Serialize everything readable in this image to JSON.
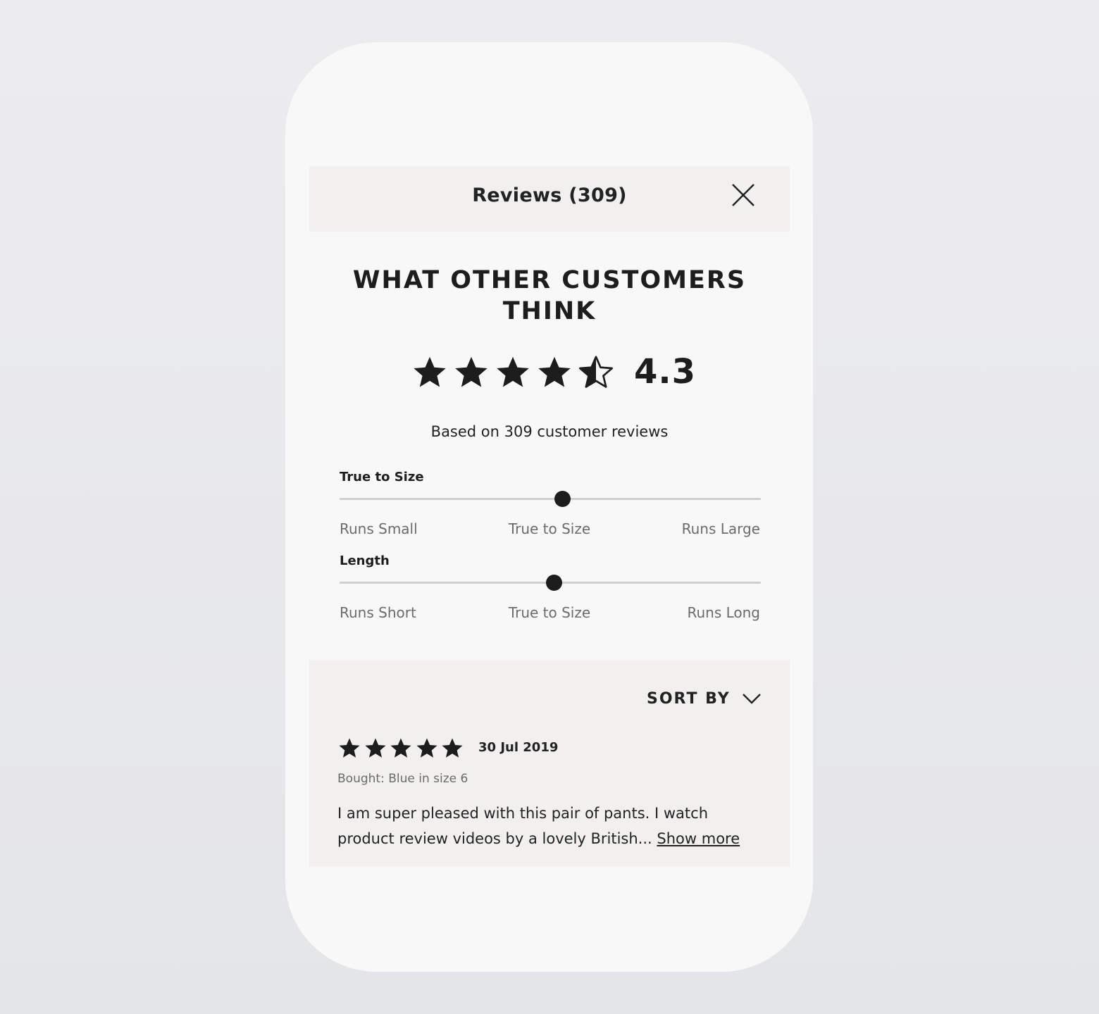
{
  "header": {
    "title": "Reviews (309)",
    "close_icon": "close-icon"
  },
  "summary": {
    "headline": "WHAT OTHER CUSTOMERS THINK",
    "rating_value": "4.3",
    "rating_stars": 4.3,
    "based_on": "Based on 309 customer reviews"
  },
  "fit": {
    "size": {
      "label": "True to Size",
      "position_fraction": 0.53,
      "min_label": "Runs Small",
      "mid_label": "True to Size",
      "max_label": "Runs Large"
    },
    "length": {
      "label": "Length",
      "position_fraction": 0.51,
      "min_label": "Runs Short",
      "mid_label": "True to Size",
      "max_label": "Runs Long"
    }
  },
  "sort": {
    "label": "SORT BY",
    "icon": "chevron-down-icon"
  },
  "review": {
    "stars": 5,
    "date": "30 Jul 2019",
    "bought": "Bought: Blue in size 6",
    "text": "I am super pleased with this pair of pants. I watch product review videos by a lovely British...",
    "show_more": "Show more"
  },
  "colors": {
    "star": "#1d1d1d",
    "panel_bg": "#f1f0ee",
    "card_bg": "#f8f8f8",
    "track": "#cfcfcf"
  }
}
